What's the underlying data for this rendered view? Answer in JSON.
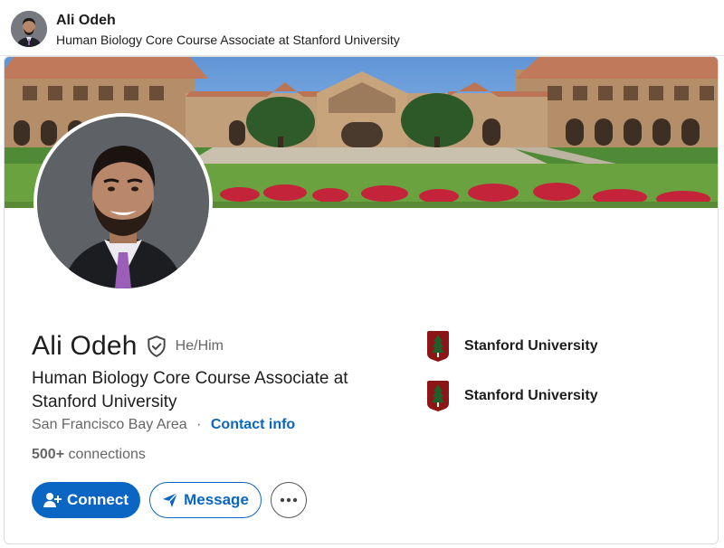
{
  "header": {
    "name": "Ali Odeh",
    "headline": "Human Biology Core Course Associate at Stanford University"
  },
  "profile": {
    "name": "Ali Odeh",
    "pronouns": "He/Him",
    "headline": "Human Biology Core Course Associate at Stanford University",
    "location": "San Francisco Bay Area",
    "contact_link": "Contact info",
    "connections_count": "500+",
    "connections_label": "connections"
  },
  "actions": {
    "connect_label": "Connect",
    "message_label": "Message"
  },
  "organizations": [
    {
      "name": "Stanford University",
      "logo": "stanford-logo-icon"
    },
    {
      "name": "Stanford University",
      "logo": "stanford-logo-icon"
    }
  ],
  "colors": {
    "brand_blue": "#0a66c2",
    "stanford_red": "#8c1515"
  }
}
